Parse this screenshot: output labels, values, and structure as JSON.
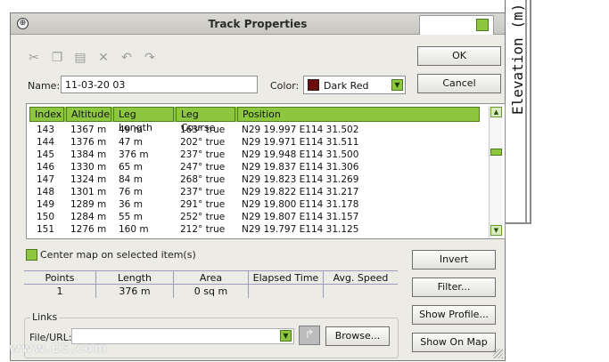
{
  "background_window": {
    "vertical_text": "Elevation (m)"
  },
  "dialog": {
    "title": "Track Properties",
    "toolbar": {
      "icons": [
        "cut-icon",
        "copy-icon",
        "paste-icon",
        "delete-icon",
        "undo-icon",
        "redo-icon"
      ]
    },
    "name_label": "Name:",
    "name_value": "11-03-20 03",
    "color_label": "Color:",
    "color_value": "Dark Red",
    "color_swatch": "#6d0a0a",
    "accent_color": "#8dc63f",
    "buttons": {
      "ok": "OK",
      "cancel": "Cancel",
      "invert": "Invert",
      "filter": "Filter...",
      "show_profile": "Show Profile...",
      "show_on_map": "Show On Map",
      "browse": "Browse..."
    },
    "table": {
      "headers": [
        "Index",
        "Altitude",
        "Leg Length",
        "Leg Course",
        "Position"
      ],
      "rows": [
        [
          "143",
          "1367 m",
          "49 m",
          "163° true",
          "N29 19.997 E114 31.502"
        ],
        [
          "144",
          "1376 m",
          "47 m",
          "202° true",
          "N29 19.971 E114 31.511"
        ],
        [
          "145",
          "1384 m",
          "376 m",
          "237° true",
          "N29 19.948 E114 31.500"
        ],
        [
          "146",
          "1330 m",
          "65 m",
          "247° true",
          "N29 19.837 E114 31.306"
        ],
        [
          "147",
          "1324 m",
          "84 m",
          "268° true",
          "N29 19.823 E114 31.269"
        ],
        [
          "148",
          "1301 m",
          "76 m",
          "237° true",
          "N29 19.822 E114 31.217"
        ],
        [
          "149",
          "1289 m",
          "36 m",
          "291° true",
          "N29 19.800 E114 31.178"
        ],
        [
          "150",
          "1284 m",
          "55 m",
          "252° true",
          "N29 19.807 E114 31.157"
        ],
        [
          "151",
          "1276 m",
          "160 m",
          "212° true",
          "N29 19.797 E114 31.125"
        ]
      ]
    },
    "center_map_label": "Center map on selected item(s)",
    "stats": {
      "headers": [
        "Points",
        "Length",
        "Area",
        "Elapsed Time",
        "Avg. Speed"
      ],
      "values": [
        "1",
        "376 m",
        "0 sq m",
        "",
        ""
      ]
    },
    "links": {
      "title": "Links",
      "file_url_label": "File/URL:",
      "file_url_value": ""
    }
  },
  "watermark": "www.ES.com"
}
